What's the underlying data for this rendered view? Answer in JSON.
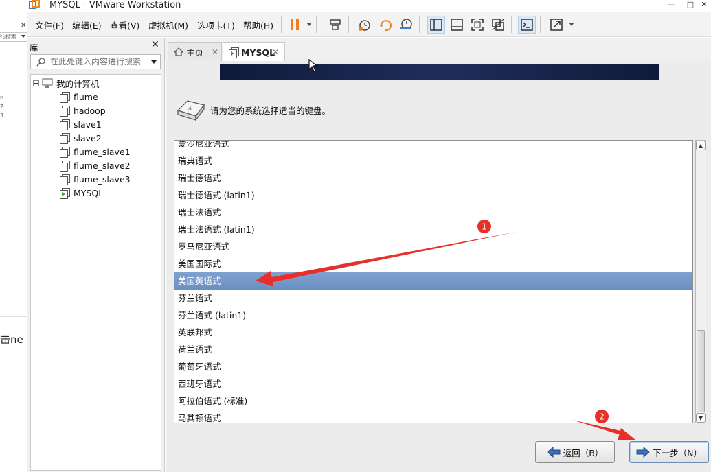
{
  "window": {
    "title": "MYSQL - VMware Workstation",
    "controls": {
      "minimize": "—",
      "maximize": "□",
      "close": "✕"
    }
  },
  "background_window": {
    "close": "✕",
    "search_text": "行搜索",
    "digits": [
      "n",
      "2",
      "3"
    ],
    "text": "击ne"
  },
  "menu": [
    {
      "label": "文件(F)"
    },
    {
      "label": "编辑(E)"
    },
    {
      "label": "查看(V)"
    },
    {
      "label": "虚拟机(M)"
    },
    {
      "label": "选项卡(T)"
    },
    {
      "label": "帮助(H)"
    }
  ],
  "toolbar": {
    "icons": [
      "pause-icon",
      "send-ctrl-alt-del-icon",
      "snapshot-icon",
      "revert-snapshot-icon",
      "snapshot-manager-icon",
      "show-library-icon",
      "thumbnail-bar-icon",
      "full-screen-icon",
      "unity-icon",
      "console-icon",
      "stretch-icon"
    ],
    "accent": "#f0801e"
  },
  "library": {
    "title": "库",
    "close": "✕",
    "search_placeholder": "在此处键入内容进行搜索",
    "root": "我的计算机",
    "vms": [
      "flume",
      "hadoop",
      "slave1",
      "slave2",
      "flume_slave1",
      "flume_slave2",
      "flume_slave3",
      "MYSQL"
    ]
  },
  "tabs": [
    {
      "label": "主页",
      "close": "✕"
    },
    {
      "label": "MYSQL",
      "close": "✕"
    }
  ],
  "installer": {
    "prompt": "请为您的系统选择适当的键盘。",
    "keyboard_layouts": [
      "爱沙尼亚语式",
      "瑞典语式",
      "瑞士德语式",
      "瑞士德语式 (latin1)",
      "瑞士法语式",
      "瑞士法语式 (latin1)",
      "罗马尼亚语式",
      "美国国际式",
      "美国英语式",
      "芬兰语式",
      "芬兰语式 (latin1)",
      "英联邦式",
      "荷兰语式",
      "葡萄牙语式",
      "西班牙语式",
      "阿拉伯语式 (标准)",
      "马其顿语式"
    ],
    "selected": "美国英语式",
    "back_button": "返回（B）",
    "next_button": "下一步（N）"
  },
  "annotations": {
    "markers": [
      "1",
      "2"
    ],
    "color": "#e8302a"
  },
  "colors": {
    "selection": "#7297c9",
    "banner": "#16234a"
  }
}
